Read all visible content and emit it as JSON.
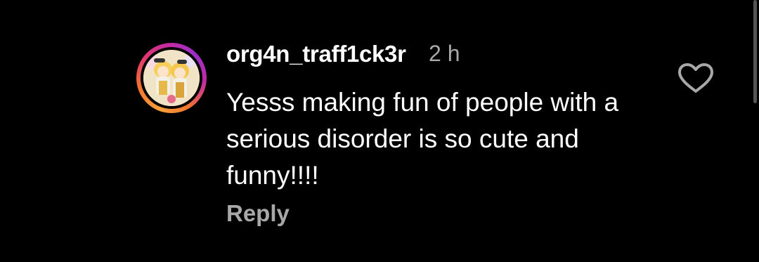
{
  "comment": {
    "username": "org4n_traff1ck3r",
    "timestamp": "2 h",
    "text": "Yesss making fun of people with a serious disorder is so cute and funny!!!!",
    "reply_label": "Reply"
  },
  "icons": {
    "like": "heart-outline-icon",
    "avatar": "user-avatar"
  },
  "colors": {
    "background": "#000000",
    "primary_text": "#ffffff",
    "secondary_text": "#a8a8a8",
    "story_ring": [
      "#f9a13a",
      "#e33a6a",
      "#c32aa3"
    ]
  }
}
